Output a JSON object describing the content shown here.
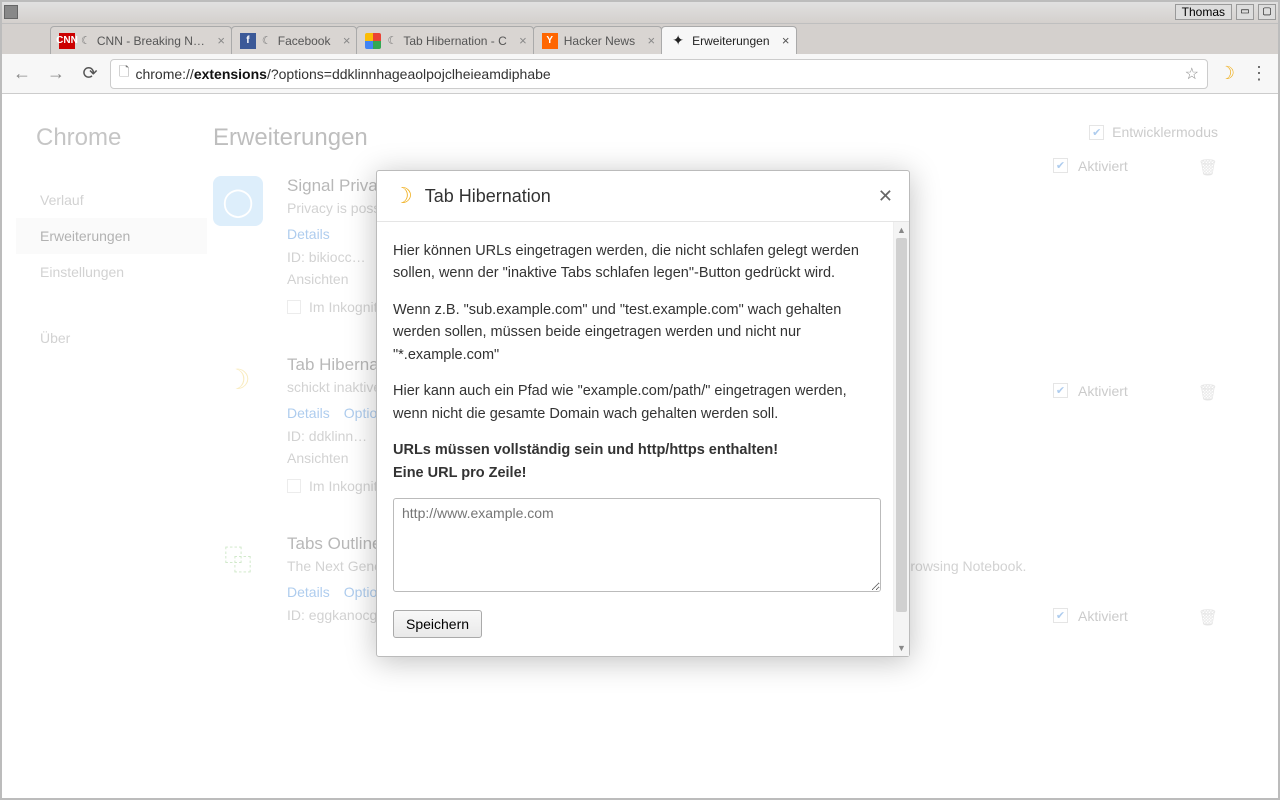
{
  "os": {
    "user": "Thomas"
  },
  "tabs": [
    {
      "label": "CNN - Breaking N…",
      "favicon": "cnn",
      "fav_text": "CNN",
      "sleeping": true
    },
    {
      "label": "Facebook",
      "favicon": "fb",
      "fav_text": "f",
      "sleeping": true
    },
    {
      "label": "Tab Hibernation - C",
      "favicon": "store",
      "fav_text": "",
      "sleeping": true
    },
    {
      "label": "Hacker News",
      "favicon": "hn",
      "fav_text": "Y",
      "sleeping": false
    },
    {
      "label": "Erweiterungen",
      "favicon": "puzzle",
      "fav_text": "✦",
      "sleeping": false,
      "active": true
    }
  ],
  "url": {
    "scheme": "chrome://",
    "host": "extensions",
    "path": "/?options=ddklinnhageaolpojclheieamdiphabe"
  },
  "sidebar": {
    "title": "Chrome",
    "items": [
      "Verlauf",
      "Erweiterungen",
      "Einstellungen",
      "Über"
    ],
    "active": 1
  },
  "page": {
    "heading": "Erweiterungen",
    "devmode_label": "Entwicklermodus"
  },
  "common": {
    "details": "Details",
    "options": "Optionen",
    "views_label": "Ansichten",
    "enabled_label": "Aktiviert",
    "incognito_label": "Im Inkognito",
    "id_prefix": "ID: "
  },
  "extensions": [
    {
      "icon": "signal",
      "title": "Signal Private Messenger",
      "desc": "Privacy is possible. Signal makes it easy.",
      "id": "bikiocc…",
      "views": ""
    },
    {
      "icon": "moon",
      "title": "Tab Hibernation",
      "desc": "schickt inaktive Tabs schlafen",
      "id": "ddklinn…",
      "views": ""
    },
    {
      "icon": "outliner",
      "title": "Tabs Outliner",
      "desc": "The Next Generation Session Manager; A Really Working Too Many Open Tabs Solution; And Your Browsing Notebook.",
      "id": "eggkanocgddhmamlbiijnphhppkpkmkl",
      "views": ""
    }
  ],
  "modal": {
    "title": "Tab Hibernation",
    "p1": "Hier können URLs eingetragen werden, die nicht schlafen gelegt werden sollen, wenn der \"inaktive Tabs schlafen legen\"-Button gedrückt wird.",
    "p2": "Wenn z.B. \"sub.example.com\" und \"test.example.com\" wach gehalten werden sollen, müssen beide eingetragen werden und nicht nur \"*.example.com\"",
    "p3": "Hier kann auch ein Pfad wie \"example.com/path/\" eingetragen werden, wenn nicht die gesamte Domain wach gehalten werden soll.",
    "bold1": "URLs müssen vollständig sein und http/https enthalten!",
    "bold2": "Eine URL pro Zeile!",
    "placeholder": "http://www.example.com",
    "save": "Speichern"
  }
}
